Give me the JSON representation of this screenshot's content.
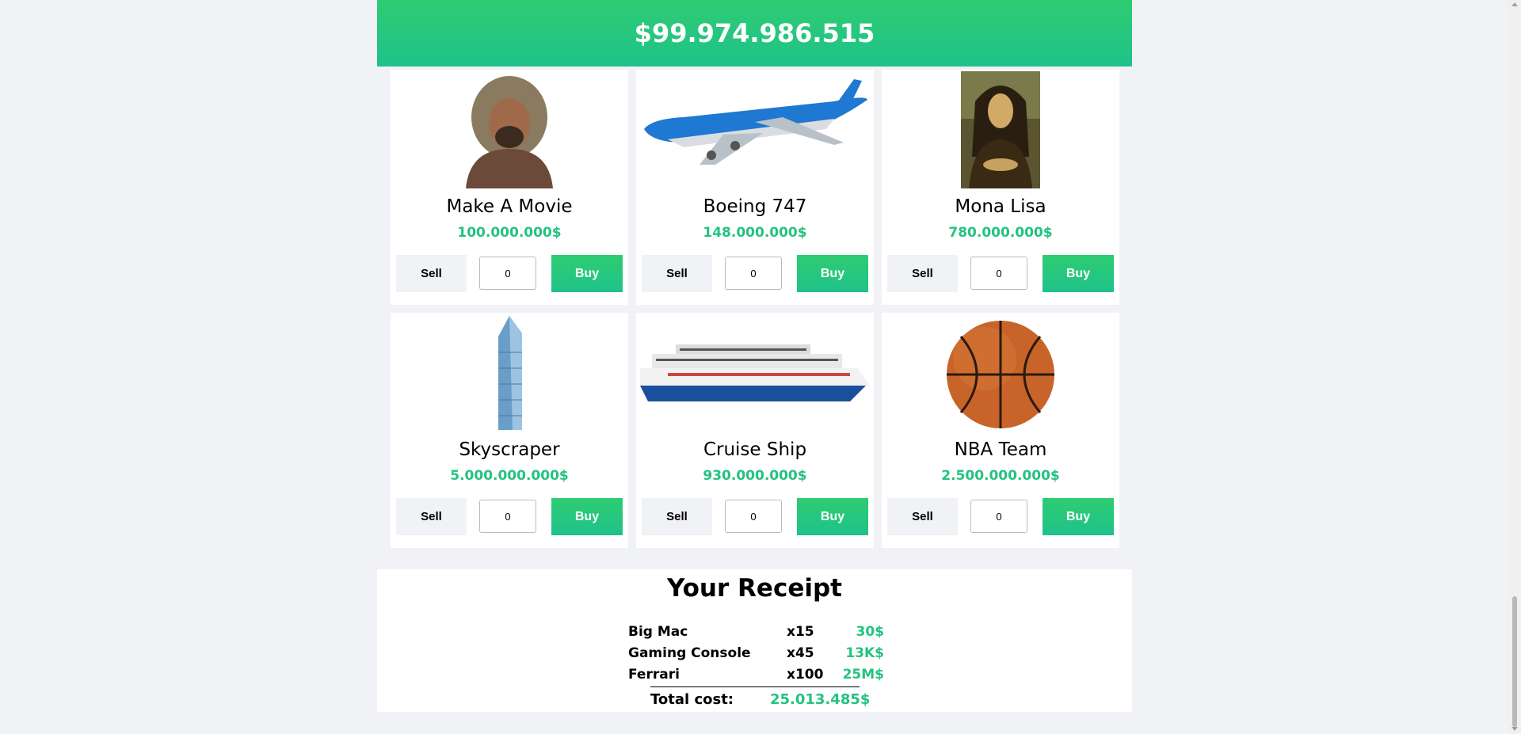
{
  "balance": "$99.974.986.515",
  "products": [
    {
      "name": "Make A Movie",
      "price": "100.000.000$",
      "sell_label": "Sell",
      "buy_label": "Buy",
      "qty": "0",
      "icon": "actor-photo"
    },
    {
      "name": "Boeing 747",
      "price": "148.000.000$",
      "sell_label": "Sell",
      "buy_label": "Buy",
      "qty": "0",
      "icon": "airplane-photo"
    },
    {
      "name": "Mona Lisa",
      "price": "780.000.000$",
      "sell_label": "Sell",
      "buy_label": "Buy",
      "qty": "0",
      "icon": "painting-photo"
    },
    {
      "name": "Skyscraper",
      "price": "5.000.000.000$",
      "sell_label": "Sell",
      "buy_label": "Buy",
      "qty": "0",
      "icon": "skyscraper-photo"
    },
    {
      "name": "Cruise Ship",
      "price": "930.000.000$",
      "sell_label": "Sell",
      "buy_label": "Buy",
      "qty": "0",
      "icon": "cruise-ship-photo"
    },
    {
      "name": "NBA Team",
      "price": "2.500.000.000$",
      "sell_label": "Sell",
      "buy_label": "Buy",
      "qty": "0",
      "icon": "basketball-photo"
    }
  ],
  "receipt": {
    "title": "Your Receipt",
    "items": [
      {
        "name": "Big Mac",
        "qty": "x15",
        "amount": "30$"
      },
      {
        "name": "Gaming Console",
        "qty": "x45",
        "amount": "13K$"
      },
      {
        "name": "Ferrari",
        "qty": "x100",
        "amount": "25M$"
      }
    ],
    "total_label": "Total cost:",
    "total_value": "25.013.485$"
  },
  "colors": {
    "accent": "#24c281",
    "accent_light": "#2ecc71",
    "background": "#f0f2f5"
  }
}
